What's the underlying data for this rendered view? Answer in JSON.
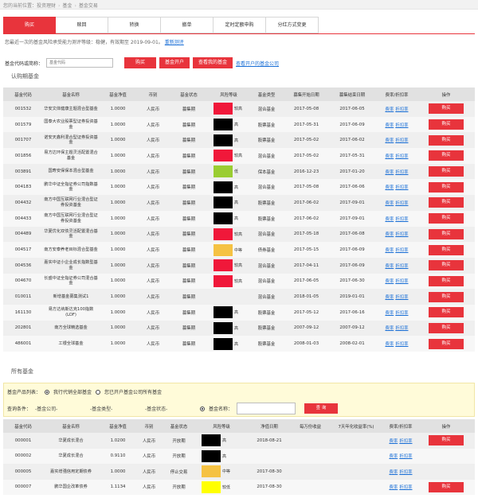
{
  "breadcrumb": [
    "您的当前位置：投资理财",
    "基金",
    "基金交易"
  ],
  "tabs": [
    "购买",
    "赎回",
    "转换",
    "撤单",
    "定时定额申购",
    "分红方式变更"
  ],
  "risk_note": {
    "text": "您最近一次的基金风险承受能力测评等级：稳健，有效期至 2019-09-01。",
    "link": "重新测评"
  },
  "search": {
    "label": "基金代码或简称：",
    "placeholder": "基金代码",
    "buy_label": "购买",
    "open_label": "基金开户",
    "my_label": "查看我的基金",
    "link_label": "查看开户的基金公司"
  },
  "section1_title": "认购期基金",
  "columns1": [
    "基金代码",
    "基金名称",
    "基金净值",
    "币别",
    "基金状态",
    "风险等级",
    "基金类型",
    "募集开始日期",
    "募集结束日期",
    "费率/折扣率",
    "操作"
  ],
  "rows1": [
    {
      "code": "001532",
      "name": "华安文体健康主题混合型基金",
      "nav": "1.0000",
      "cur": "人民币",
      "status": "募集期",
      "risk_color": "#f0183a",
      "risk_text": "较高",
      "type": "混合基金",
      "start": "2017-05-08",
      "end": "2017-06-05"
    },
    {
      "code": "001579",
      "name": "国泰大农业股票型证券投资基金",
      "nav": "1.0000",
      "cur": "人民币",
      "status": "募集期",
      "risk_color": "#000000",
      "risk_text": "高",
      "type": "股票基金",
      "start": "2017-05-31",
      "end": "2017-06-09"
    },
    {
      "code": "001707",
      "name": "诺安天鑫利混合型证券投资基金",
      "nav": "1.0000",
      "cur": "人民币",
      "status": "募集期",
      "risk_color": "#000000",
      "risk_text": "高",
      "type": "股票基金",
      "start": "2017-05-02",
      "end": "2017-06-02"
    },
    {
      "code": "001856",
      "name": "易方达环保主题灵活配置混合基金",
      "nav": "1.0000",
      "cur": "人民币",
      "status": "募集期",
      "risk_color": "#f0183a",
      "risk_text": "较高",
      "type": "混合基金",
      "start": "2017-05-02",
      "end": "2017-05-31"
    },
    {
      "code": "003891",
      "name": "国寿安保保本混合型基金",
      "nav": "1.0000",
      "cur": "人民币",
      "status": "募集期",
      "risk_color": "#9acd32",
      "risk_text": "低",
      "type": "保本基金",
      "start": "2016-12-23",
      "end": "2017-01-20"
    },
    {
      "code": "004183",
      "name": "鹏华中证全指证券公司指数基金",
      "nav": "1.0000",
      "cur": "人民币",
      "status": "募集期",
      "risk_color": "#000000",
      "risk_text": "高",
      "type": "混合基金",
      "start": "2017-05-08",
      "end": "2017-06-06"
    },
    {
      "code": "004432",
      "name": "南方中国互联网行业混合型证券投资基金",
      "nav": "1.0000",
      "cur": "人民币",
      "status": "募集期",
      "risk_color": "#000000",
      "risk_text": "高",
      "type": "股票基金",
      "start": "2017-06-02",
      "end": "2017-09-01"
    },
    {
      "code": "004433",
      "name": "南方中国互联网行业混合型证券投资基金",
      "nav": "1.0000",
      "cur": "人民币",
      "status": "募集期",
      "risk_color": "#000000",
      "risk_text": "高",
      "type": "股票基金",
      "start": "2017-06-02",
      "end": "2017-09-01"
    },
    {
      "code": "004489",
      "name": "华夏优化双债灵活配置混合基金",
      "nav": "1.0000",
      "cur": "人民币",
      "status": "募集期",
      "risk_color": "#f0183a",
      "risk_text": "较高",
      "type": "混合基金",
      "start": "2017-05-18",
      "end": "2017-06-08"
    },
    {
      "code": "004517",
      "name": "南方安泰养老目标混合型基金",
      "nav": "1.0000",
      "cur": "人民币",
      "status": "募集期",
      "risk_color": "#f5c243",
      "risk_text": "中等",
      "type": "债券基金",
      "start": "2017-05-15",
      "end": "2017-06-09"
    },
    {
      "code": "004536",
      "name": "嘉实中证小企业成长指数型基金",
      "nav": "1.0000",
      "cur": "人民币",
      "status": "募集期",
      "risk_color": "#f0183a",
      "risk_text": "较高",
      "type": "混合基金",
      "start": "2017-04-11",
      "end": "2017-06-09"
    },
    {
      "code": "004670",
      "name": "长盛中证全指证券公司混合基金",
      "nav": "1.0000",
      "cur": "人民币",
      "status": "募集期",
      "risk_color": "#f0183a",
      "risk_text": "较高",
      "type": "混合基金",
      "start": "2017-06-05",
      "end": "2017-06-30"
    },
    {
      "code": "010011",
      "name": "新增基金募集测试1",
      "nav": "1.0000",
      "cur": "人民币",
      "status": "募集期",
      "risk_color": "",
      "risk_text": "",
      "type": "混合基金",
      "start": "2018-01-05",
      "end": "2019-01-01"
    },
    {
      "code": "161130",
      "name": "易方达纳斯达克100指数(LOF)",
      "nav": "1.0000",
      "cur": "人民币",
      "status": "募集期",
      "risk_color": "#000000",
      "risk_text": "高",
      "type": "股票基金",
      "start": "2017-05-12",
      "end": "2017-06-16"
    },
    {
      "code": "202801",
      "name": "南方全球精选基金",
      "nav": "1.0000",
      "cur": "人民币",
      "status": "募集期",
      "risk_color": "#000000",
      "risk_text": "高",
      "type": "股票基金",
      "start": "2007-09-12",
      "end": "2007-09-12"
    },
    {
      "code": "486001",
      "name": "工银全球基金",
      "nav": "1.0000",
      "cur": "人民币",
      "status": "募集期",
      "risk_color": "#000000",
      "risk_text": "高",
      "type": "股票基金",
      "start": "2008-01-03",
      "end": "2008-02-01"
    }
  ],
  "row_links": {
    "fee": "费率",
    "discount": "折扣率",
    "buy": "购买"
  },
  "section2_title": "所有基金",
  "filter": {
    "list_label": "基金产品列表：",
    "opt1": "我行代销全部基金",
    "opt2": "您已开户基金公司所有基金",
    "cond_label": "查询条件：",
    "company": "-基金公司-",
    "type": "-基金类型-",
    "status": "-基金状态-",
    "name_label": "基金名称：",
    "search_btn": "查 询"
  },
  "columns2": [
    "基金代码",
    "基金名称",
    "基金净值",
    "币别",
    "基金状态",
    "风险等级",
    "净值日期",
    "每万份收益",
    "7天年化收益率(%)",
    "费率/折扣率",
    "操作"
  ],
  "rows2": [
    {
      "code": "000001",
      "name": "华夏成长混合",
      "nav": "1.0200",
      "cur": "人民币",
      "status": "开放期",
      "risk_color": "#000000",
      "risk_text": "高",
      "date": "2018-08-21",
      "buy": true
    },
    {
      "code": "000002",
      "name": "华夏成长混合",
      "nav": "0.9110",
      "cur": "人民币",
      "status": "开放期",
      "risk_color": "#000000",
      "risk_text": "高",
      "date": "",
      "buy": false
    },
    {
      "code": "000005",
      "name": "嘉实增强信用定期债券",
      "nav": "1.0000",
      "cur": "人民币",
      "status": "停止交易",
      "risk_color": "#f5c243",
      "risk_text": "中等",
      "date": "2017-08-30",
      "buy": false
    },
    {
      "code": "000007",
      "name": "鹏华国企改革债券",
      "nav": "1.1134",
      "cur": "人民币",
      "status": "开放期",
      "risk_color": "#ffff00",
      "risk_text": "较低",
      "date": "2017-08-30",
      "buy": true
    }
  ]
}
